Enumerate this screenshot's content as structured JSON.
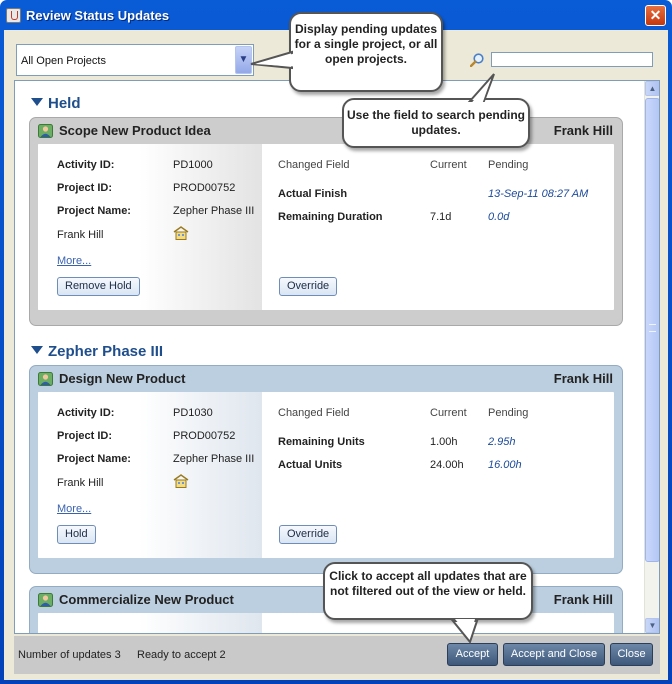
{
  "window": {
    "title": "Review Status Updates",
    "close_glyph": "✕"
  },
  "filter": {
    "selected": "All Open Projects",
    "search_value": ""
  },
  "groups": [
    {
      "name": "Held",
      "card": {
        "title": "Scope New Product Idea",
        "owner": "Frank Hill",
        "activity_label": "Activity ID:",
        "activity_id": "PD1000",
        "project_label": "Project ID:",
        "project_id": "PROD00752",
        "project_name_label": "Project Name:",
        "project_name": "Zepher Phase III",
        "resource": "Frank Hill",
        "more": "More...",
        "action_button": "Remove Hold",
        "override_button": "Override",
        "col_changed_field": "Changed Field",
        "col_current": "Current",
        "col_pending": "Pending",
        "rows": [
          {
            "field": "Actual Finish",
            "current": "",
            "pending": "13-Sep-11 08:27 AM"
          },
          {
            "field": "Remaining Duration",
            "current": "7.1d",
            "pending": "0.0d"
          }
        ]
      }
    },
    {
      "name": "Zepher Phase III",
      "card": {
        "title": "Design New Product",
        "owner": "Frank Hill",
        "activity_label": "Activity ID:",
        "activity_id": "PD1030",
        "project_label": "Project ID:",
        "project_id": "PROD00752",
        "project_name_label": "Project Name:",
        "project_name": "Zepher Phase III",
        "resource": "Frank Hill",
        "more": "More...",
        "action_button": "Hold",
        "override_button": "Override",
        "col_changed_field": "Changed Field",
        "col_current": "Current",
        "col_pending": "Pending",
        "rows": [
          {
            "field": "Remaining Units",
            "current": "1.00h",
            "pending": "2.95h"
          },
          {
            "field": "Actual Units",
            "current": "24.00h",
            "pending": "16.00h"
          }
        ]
      }
    }
  ],
  "third_card": {
    "title": "Commercialize New Product",
    "owner": "Frank Hill"
  },
  "status": {
    "updates": "Number of updates 3",
    "ready": "Ready to accept 2"
  },
  "buttons": {
    "accept": "Accept",
    "accept_close": "Accept and Close",
    "close": "Close"
  },
  "callouts": {
    "project_filter": "Display pending updates for a single project, or all open projects.",
    "search": "Use the field to search pending updates.",
    "accept": "Click to accept all updates that are not filtered out of the view or held."
  },
  "colors": {
    "title_bar": "#0a5bd6",
    "group_header": "#1f4e8c",
    "pending_value": "#1c4a9a",
    "footer_button": "#4f6a8e"
  },
  "icons": [
    "window-app-icon",
    "close-icon",
    "dropdown-arrow-icon",
    "search-icon",
    "collapse-triangle-icon",
    "person-icon",
    "house-icon",
    "scroll-up-icon",
    "scroll-down-icon"
  ]
}
